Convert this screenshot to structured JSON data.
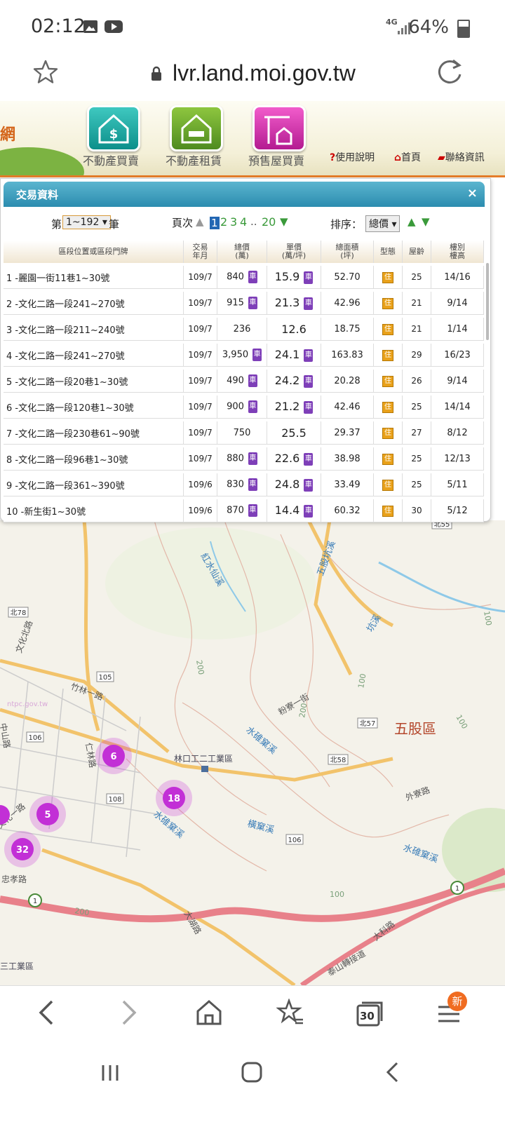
{
  "status": {
    "time": "02:12",
    "network": "4G",
    "battery": "64%"
  },
  "browser": {
    "url": "lvr.land.moi.gov.tw",
    "tabs_count": "30",
    "badge": "新"
  },
  "header": {
    "logo_text": "網",
    "nav": [
      "不動產買賣",
      "不動產租賃",
      "預售屋買賣"
    ],
    "links": [
      "使用說明",
      "首頁",
      "聯絡資訊"
    ]
  },
  "panel": {
    "title": "交易資料",
    "close": "×",
    "record_prefix": "第",
    "record_range": "1~192",
    "record_suffix": "筆",
    "page_label": "頁次",
    "pages": [
      "1",
      "2",
      "3",
      "4",
      "..",
      "20"
    ],
    "sort_label": "排序：",
    "sort_value": "總價",
    "columns": [
      "區段位置或區段門牌",
      "交易\n年月",
      "總價\n(萬)",
      "單價\n(萬/坪)",
      "總面積\n(坪)",
      "型態",
      "屋齡",
      "樓別\n樓高"
    ],
    "rows": [
      {
        "addr": "1 -麗園一街11巷1~30號",
        "date": "109/7",
        "total": "840",
        "car1": true,
        "unit": "15.9",
        "car2": true,
        "area": "52.70",
        "type": "住",
        "age": "25",
        "floor": "14/16"
      },
      {
        "addr": "2 -文化二路一段241~270號",
        "date": "109/7",
        "total": "915",
        "car1": true,
        "unit": "21.3",
        "car2": true,
        "area": "42.96",
        "type": "住",
        "age": "21",
        "floor": "9/14"
      },
      {
        "addr": "3 -文化二路一段211~240號",
        "date": "109/7",
        "total": "236",
        "car1": false,
        "unit": "12.6",
        "car2": false,
        "area": "18.75",
        "type": "住",
        "age": "21",
        "floor": "1/14"
      },
      {
        "addr": "4 -文化二路一段241~270號",
        "date": "109/7",
        "total": "3,950",
        "car1": true,
        "unit": "24.1",
        "car2": true,
        "area": "163.83",
        "type": "住",
        "age": "29",
        "floor": "16/23"
      },
      {
        "addr": "5 -文化二路一段20巷1~30號",
        "date": "109/7",
        "total": "490",
        "car1": true,
        "unit": "24.2",
        "car2": true,
        "area": "20.28",
        "type": "住",
        "age": "26",
        "floor": "9/14"
      },
      {
        "addr": "6 -文化二路一段120巷1~30號",
        "date": "109/7",
        "total": "900",
        "car1": true,
        "unit": "21.2",
        "car2": true,
        "area": "42.46",
        "type": "住",
        "age": "25",
        "floor": "14/14"
      },
      {
        "addr": "7 -文化二路一段230巷61~90號",
        "date": "109/7",
        "total": "750",
        "car1": false,
        "unit": "25.5",
        "car2": false,
        "area": "29.37",
        "type": "住",
        "age": "27",
        "floor": "8/12"
      },
      {
        "addr": "8 -文化二路一段96巷1~30號",
        "date": "109/7",
        "total": "880",
        "car1": true,
        "unit": "22.6",
        "car2": true,
        "area": "38.98",
        "type": "住",
        "age": "25",
        "floor": "12/13"
      },
      {
        "addr": "9 -文化二路一段361~390號",
        "date": "109/6",
        "total": "830",
        "car1": true,
        "unit": "24.8",
        "car2": true,
        "area": "33.49",
        "type": "住",
        "age": "25",
        "floor": "5/11"
      },
      {
        "addr": "10 -新生街1~30號",
        "date": "109/6",
        "total": "870",
        "car1": true,
        "unit": "14.4",
        "car2": true,
        "area": "60.32",
        "type": "住",
        "age": "30",
        "floor": "5/12"
      }
    ],
    "car_label": "車"
  },
  "map": {
    "district": "五股區",
    "industrial": "林口工二工業區",
    "industrial2": "三工業區",
    "labels": [
      "紅水仙溪",
      "五股坑溪",
      "坑溪",
      "粉寮一街",
      "水碓窠溪",
      "外寮路",
      "橫窠溪",
      "大科路",
      "泰山轉接道",
      "竹林一路",
      "文化一路",
      "中山路",
      "仁林路",
      "忠孝路",
      "大湖路",
      "文化北路"
    ],
    "route_shields": [
      "北78",
      "105",
      "106",
      "108",
      "北57",
      "北58",
      "106",
      "北55",
      "1",
      "1"
    ],
    "contours": [
      "200",
      "200",
      "100",
      "100",
      "100",
      "200",
      "100",
      "100"
    ],
    "clusters": [
      {
        "count": "6"
      },
      {
        "count": "18"
      },
      {
        "count": "5"
      },
      {
        "count": "32"
      }
    ],
    "watermark": "ntpc.gov.tw"
  },
  "colors": {
    "accent": "#2b8caf",
    "car": "#7e3fb8",
    "cluster": "#c22fd6",
    "road": "#f2c36b"
  }
}
